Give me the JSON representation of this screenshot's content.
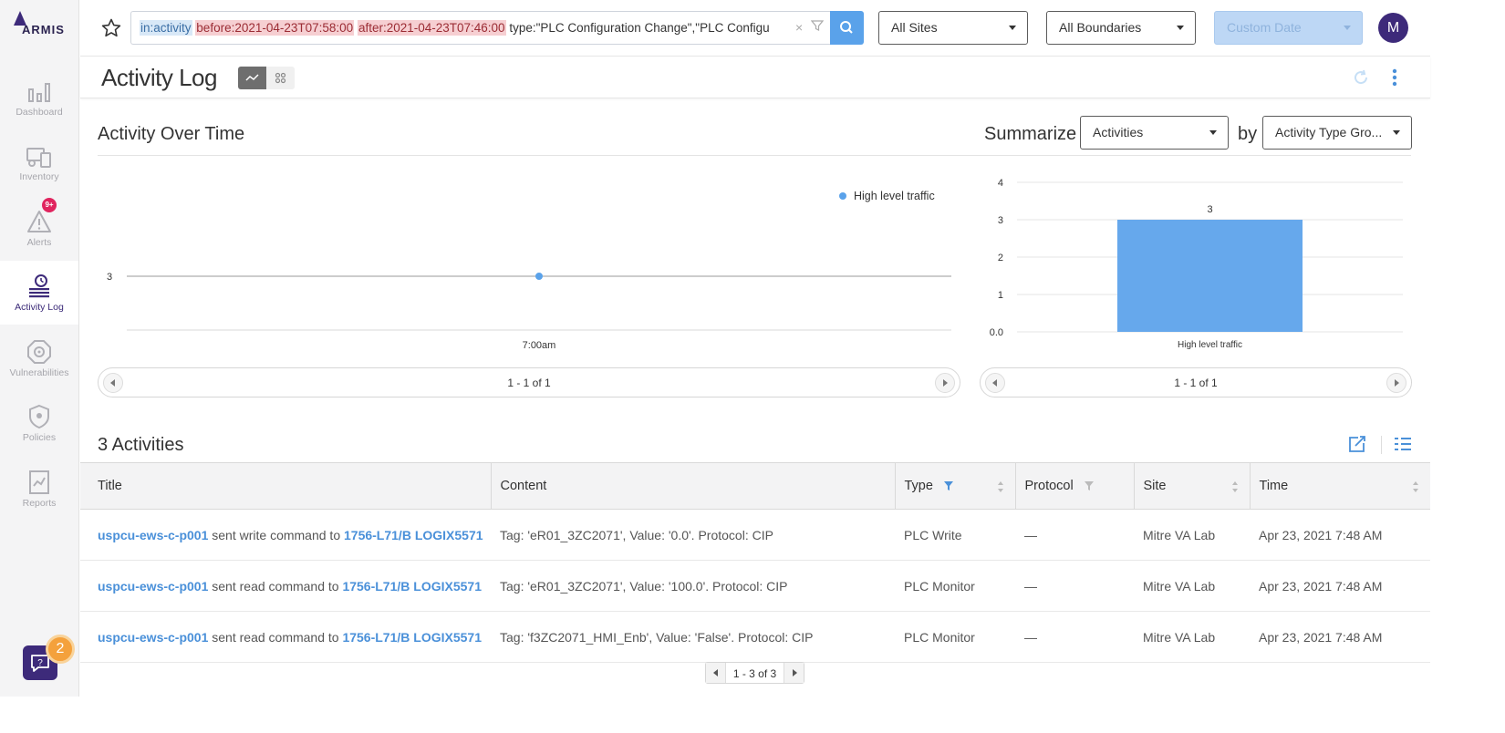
{
  "brand": {
    "logo_text": "ARMIS",
    "accent": "#3d2a7a",
    "link": "#4a90d9"
  },
  "sidebar": {
    "items": [
      {
        "label": "Dashboard",
        "icon": "bar-chart-icon"
      },
      {
        "label": "Inventory",
        "icon": "devices-icon"
      },
      {
        "label": "Alerts",
        "icon": "warning-icon",
        "badge": "9+"
      },
      {
        "label": "Activity Log",
        "icon": "activity-log-icon",
        "active": true
      },
      {
        "label": "Vulnerabilities",
        "icon": "biohazard-icon"
      },
      {
        "label": "Policies",
        "icon": "shield-icon"
      },
      {
        "label": "Reports",
        "icon": "report-icon"
      }
    ],
    "help_count": "2"
  },
  "topbar": {
    "query": {
      "tok_in": "in:activity",
      "tok_before": "before:2021-04-23T07:58:00",
      "tok_after": "after:2021-04-23T07:46:00",
      "rest": "type:\"PLC Configuration Change\",\"PLC Configu"
    },
    "sites_select": "All Sites",
    "boundaries_select": "All Boundaries",
    "date_select": "Custom Date",
    "avatar_initial": "M"
  },
  "header": {
    "title": "Activity Log"
  },
  "activity_over_time": {
    "title": "Activity Over Time",
    "summarize_label": "Summarize",
    "summarize_select": "Activities",
    "by_label": "by",
    "by_select": "Activity Type Gro...",
    "pager_text": "1 - 1 of 1"
  },
  "chart_data": [
    {
      "type": "line",
      "series": [
        {
          "name": "High level traffic",
          "values": [
            3
          ]
        }
      ],
      "x": [
        "7:00am"
      ],
      "y_tick_labels": [
        "3"
      ],
      "legend": "top-right",
      "color": "#5aa2ea"
    },
    {
      "type": "bar",
      "categories": [
        "High level traffic"
      ],
      "values": [
        3
      ],
      "data_labels": [
        "3"
      ],
      "y_ticks": [
        "0.0",
        "1",
        "2",
        "3",
        "4"
      ],
      "ylim": [
        0,
        4
      ],
      "color": "#66a8ec"
    }
  ],
  "bar_pager_text": "1 - 1 of 1",
  "activities": {
    "title": "3 Activities",
    "columns": [
      "Title",
      "Content",
      "Type",
      "Protocol",
      "Site",
      "Time"
    ],
    "rows": [
      {
        "src": "uspcu-ews-c-p001",
        "verb": " sent write command to ",
        "dst": "1756-L71/B LOGIX5571",
        "content": "Tag: 'eR01_3ZC2071', Value: '0.0'. Protocol: CIP",
        "type": "PLC Write",
        "protocol": "—",
        "site": "Mitre VA Lab",
        "time": "Apr 23, 2021 7:48 AM"
      },
      {
        "src": "uspcu-ews-c-p001",
        "verb": " sent read command to ",
        "dst": "1756-L71/B LOGIX5571",
        "content": "Tag: 'eR01_3ZC2071', Value: '100.0'. Protocol: CIP",
        "type": "PLC Monitor",
        "protocol": "—",
        "site": "Mitre VA Lab",
        "time": "Apr 23, 2021 7:48 AM"
      },
      {
        "src": "uspcu-ews-c-p001",
        "verb": " sent read command to ",
        "dst": "1756-L71/B LOGIX5571",
        "content": "Tag: 'f3ZC2071_HMI_Enb', Value: 'False'. Protocol: CIP",
        "type": "PLC Monitor",
        "protocol": "—",
        "site": "Mitre VA Lab",
        "time": "Apr 23, 2021 7:48 AM"
      }
    ],
    "pager_text": "1 - 3 of 3"
  }
}
